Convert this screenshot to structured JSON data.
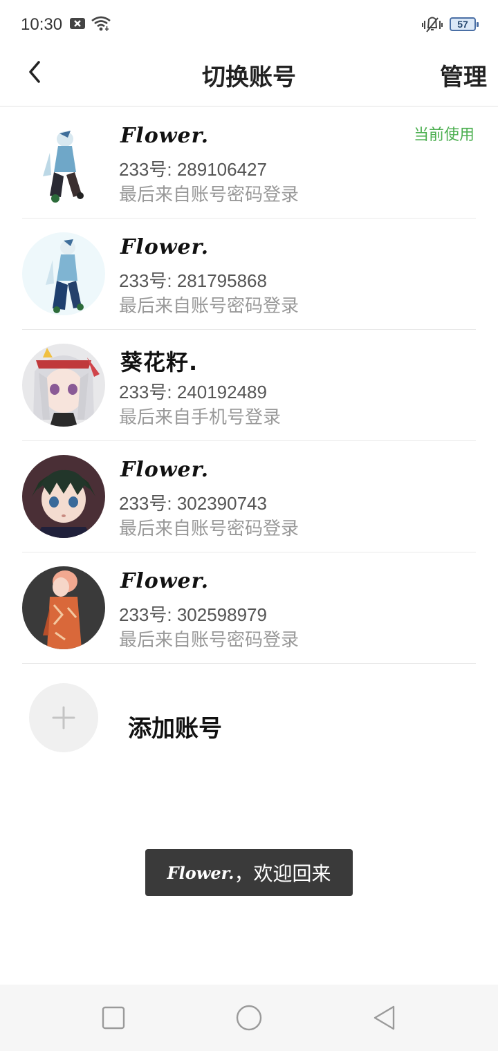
{
  "status_bar": {
    "time": "10:30",
    "battery": "57",
    "icons": [
      "notification-x-icon",
      "wifi-icon",
      "vibrate-icon",
      "battery-icon"
    ]
  },
  "header": {
    "title": "切换账号",
    "manage_label": "管理",
    "back_icon": "chevron-left-icon"
  },
  "accounts": [
    {
      "nickname": "Flower.",
      "uid": "233号: 289106427",
      "login_source": "最后来自账号密码登录",
      "current_label": "当前使用"
    },
    {
      "nickname": "Flower.",
      "uid": "233号: 281795868",
      "login_source": "最后来自账号密码登录"
    },
    {
      "nickname": "葵花籽.",
      "uid": "233号: 240192489",
      "login_source": "最后来自手机号登录"
    },
    {
      "nickname": "Flower.",
      "uid": "233号: 302390743",
      "login_source": "最后来自账号密码登录"
    },
    {
      "nickname": "Flower.",
      "uid": "233号: 302598979",
      "login_source": "最后来自账号密码登录"
    }
  ],
  "add_account": {
    "label": "添加账号",
    "icon": "plus-icon"
  },
  "toast": {
    "name": "Flower.",
    "message": "，欢迎回来"
  },
  "nav": [
    "recents-square-icon",
    "home-circle-icon",
    "back-triangle-icon"
  ],
  "colors": {
    "current_green": "#4caf50",
    "toast_bg": "#3a3a3a",
    "navbar_bg": "#f6f6f6"
  }
}
